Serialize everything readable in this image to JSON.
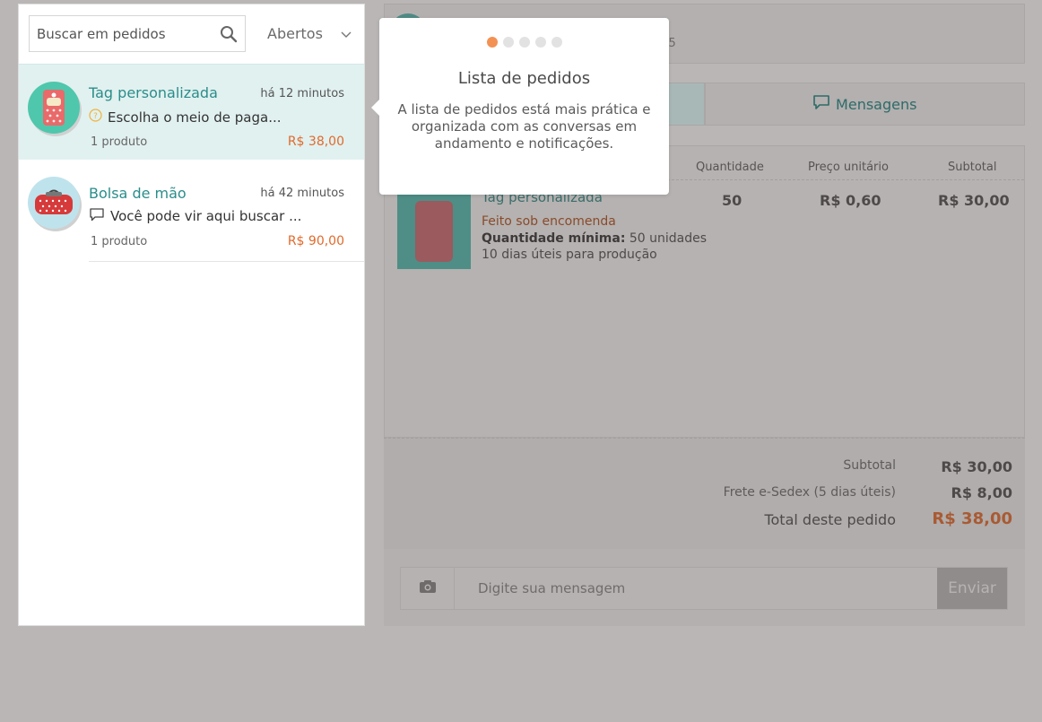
{
  "search": {
    "placeholder": "Buscar em pedidos"
  },
  "filter": {
    "selected": "Abertos"
  },
  "orders": [
    {
      "title": "Tag personalizada",
      "time": "há 12 minutos",
      "message": "Escolha o meio de paga...",
      "message_icon": "clock-question-icon",
      "count": "1 produto",
      "price": "R$ 38,00",
      "selected": true
    },
    {
      "title": "Bolsa de mão",
      "time": "há 42 minutos",
      "message": "Você pode vir aqui buscar ...",
      "message_icon": "speech-bubble-icon",
      "count": "1 produto",
      "price": "R$ 90,00",
      "selected": false
    }
  ],
  "tooltip": {
    "title": "Lista de pedidos",
    "body": "A lista de pedidos está mais prática e organizada com as conversas em andamento e notificações.",
    "steps_total": 5,
    "step_active": 1
  },
  "header": {
    "date_fragment": "015"
  },
  "tabs": {
    "messages_label": "Mensagens"
  },
  "table": {
    "headers": {
      "quantity": "Quantidade",
      "unit_price": "Preço unitário",
      "subtotal": "Subtotal"
    },
    "product": {
      "name": "Tag personalizada",
      "made_to_order": "Feito sob encomenda",
      "min_qty_label": "Quantidade mínima:",
      "min_qty_value": "50 unidades",
      "production_time": "10 dias úteis para produção",
      "quantity": "50",
      "unit_price": "R$ 0,60",
      "subtotal": "R$ 30,00"
    }
  },
  "totals": {
    "subtotal_label": "Subtotal",
    "subtotal_value": "R$ 30,00",
    "shipping_label": "Frete e-Sedex (5 dias úteis)",
    "shipping_value": "R$ 8,00",
    "total_label": "Total deste pedido",
    "total_value": "R$ 38,00"
  },
  "composer": {
    "placeholder": "Digite sua mensagem",
    "send_label": "Enviar"
  },
  "colors": {
    "accent": "#2a8d8a",
    "price": "#e06a2c",
    "active_dot": "#f39154",
    "selected_row": "#e1f1f0"
  }
}
